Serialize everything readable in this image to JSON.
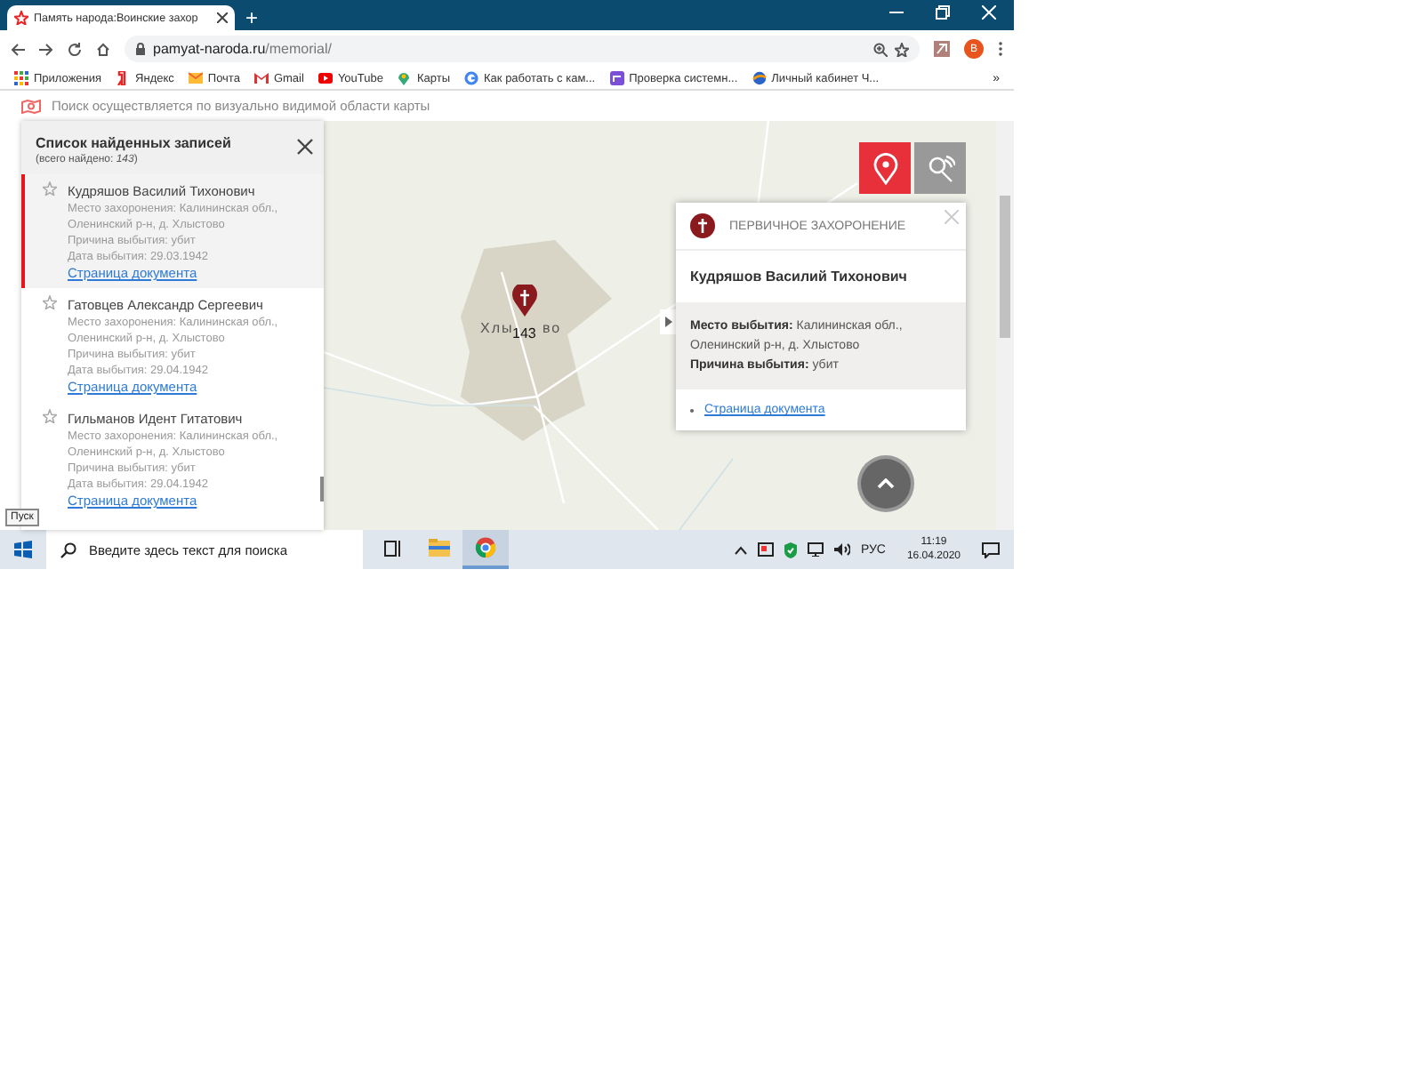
{
  "browser": {
    "tab_title": "Память народа:Воинские захор",
    "new_tab": "+",
    "url_host": "pamyat-naroda.ru",
    "url_path": "/memorial/",
    "profile": "В"
  },
  "bookmarks": [
    {
      "label": "Приложения",
      "kind": "apps"
    },
    {
      "label": "Яндекс",
      "kind": "yandex"
    },
    {
      "label": "Почта",
      "kind": "mail"
    },
    {
      "label": "Gmail",
      "kind": "gmail"
    },
    {
      "label": "YouTube",
      "kind": "youtube"
    },
    {
      "label": "Карты",
      "kind": "maps"
    },
    {
      "label": "Как работать с кам...",
      "kind": "google"
    },
    {
      "label": "Проверка системн...",
      "kind": "check"
    },
    {
      "label": "Личный кабинет Ч...",
      "kind": "globe"
    }
  ],
  "bookmarks_more": "»",
  "notice": "Поиск осуществляется по визуально видимой области карты",
  "records_panel": {
    "title": "Список найденных записей",
    "subtitle": "(всего найдено: *143*)"
  },
  "records": [
    {
      "name": "Кудряшов Василий Тихонович",
      "burial": "Место захоронения: Калининская обл., Оленинский р-н, д. Хлыстово",
      "cause": "Причина выбытия: убит",
      "date": "Дата выбытия: 29.03.1942",
      "link": "Страница документа",
      "selected": true
    },
    {
      "name": "Гатовцев Александр Сергеевич",
      "burial": "Место захоронения: Калининская обл., Оленинский р-н, д. Хлыстово",
      "cause": "Причина выбытия: убит",
      "date": "Дата выбытия: 29.04.1942",
      "link": "Страница документа",
      "selected": false
    },
    {
      "name": "Гильманов Идент Гитатович",
      "burial": "Место захоронения: Калининская обл., Оленинский р-н, д. Хлыстово",
      "cause": "Причина выбытия: убит",
      "date": "Дата выбытия: 29.04.1942",
      "link": "Страница документа",
      "selected": false
    }
  ],
  "map": {
    "label_left": "Хлы",
    "count": "143",
    "label_right": "во",
    "buttons": [
      {
        "kind": "marker",
        "selected": true
      },
      {
        "kind": "satellite",
        "selected": false
      }
    ],
    "popup": {
      "type": "ПЕРВИЧНОЕ ЗАХОРОНЕНИЕ",
      "name": "Кудряшов Василий Тихонович",
      "place": "**Место выбытия:** Калининская обл., Оленинский р-н, д. Хлыстово",
      "cause": "**Причина выбытия:** убит",
      "link": "Страница документа"
    }
  },
  "taskbar": {
    "start_tooltip": "Пуск",
    "search_placeholder": "Введите здесь текст для поиска",
    "lang": "РУС",
    "time": "11:19",
    "date": "16.04.2020"
  }
}
